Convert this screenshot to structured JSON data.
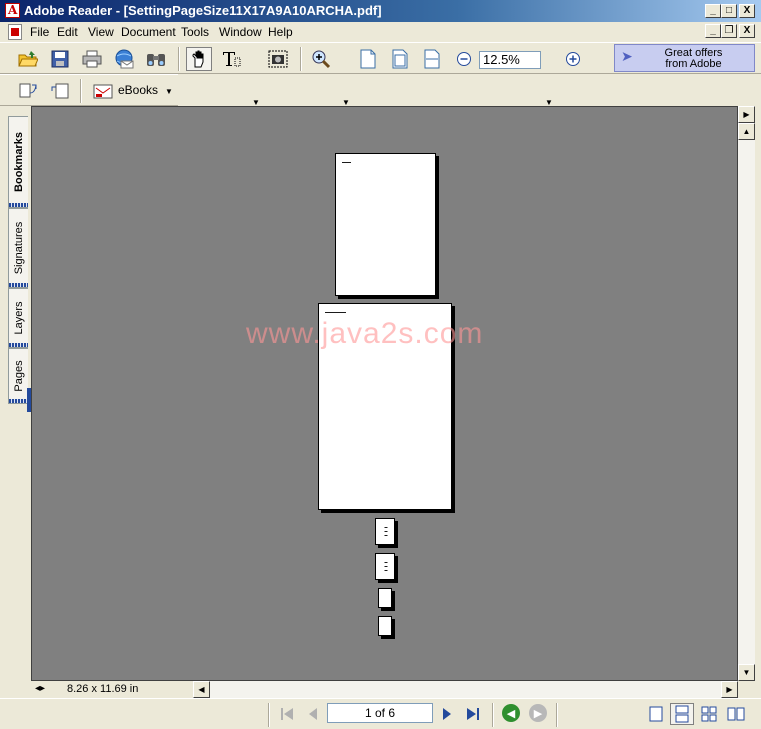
{
  "window": {
    "title": "Adobe Reader - [SettingPageSize11X17A9A10ARCHA.pdf]",
    "controls": [
      "_",
      "□",
      "X"
    ],
    "doc_controls": [
      "_",
      "❐",
      "X"
    ]
  },
  "menu": {
    "items": [
      "File",
      "Edit",
      "View",
      "Document",
      "Tools",
      "Window",
      "Help"
    ]
  },
  "toolbar": {
    "zoom_value": "12.5%",
    "ebooks_label": "eBooks",
    "offer_line1": "Great offers",
    "offer_line2": "from Adobe"
  },
  "nav_tabs": [
    "Bookmarks",
    "Signatures",
    "Layers",
    "Pages"
  ],
  "document": {
    "watermark": "www.java2s.com",
    "page_sizes": [
      {
        "label": "Page 1",
        "width_in": 8.26,
        "height_in": 11.69
      },
      {
        "label": "Page 2",
        "width_in": 11,
        "height_in": 17
      },
      {
        "label": "Page 3",
        "width_in": 1.46,
        "height_in": 2.05
      },
      {
        "label": "Page 4",
        "width_in": 1.46,
        "height_in": 2.05
      },
      {
        "label": "Page 5",
        "width_in": 1.02,
        "height_in": 1.46
      },
      {
        "label": "Page 6",
        "width_in": 1.02,
        "height_in": 1.46
      }
    ]
  },
  "status": {
    "page_size": "8.26 x 11.69 in",
    "page_indicator": "1 of 6"
  }
}
